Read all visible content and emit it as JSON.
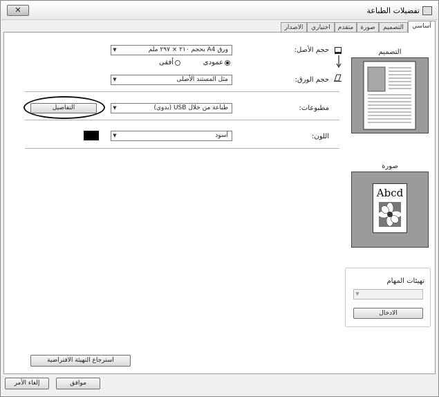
{
  "window": {
    "title": "تفضيلات الطباعة",
    "close_label": "✕"
  },
  "tabs": [
    {
      "label": "أساسي",
      "active": true
    },
    {
      "label": "التصميم",
      "active": false
    },
    {
      "label": "صورة",
      "active": false
    },
    {
      "label": "متقدم",
      "active": false
    },
    {
      "label": "اختياري",
      "active": false
    },
    {
      "label": "الاصدار",
      "active": false
    }
  ],
  "basic": {
    "original_size": {
      "label": "حجم الأصل:",
      "value": "ورق A4 بحجم ٢١٠ × ٢٩٧ ملم"
    },
    "orientation": {
      "portrait_label": "عمودى",
      "landscape_label": "أفقى",
      "selected": "portrait"
    },
    "paper_size": {
      "label": "حجم الورق:",
      "value": "مثل المستند الأصلى"
    },
    "output": {
      "label": "مطبوعات:",
      "value": "طباعة من خلال USB (بدوى)",
      "details_button": "التفاصيل"
    },
    "color": {
      "label": "اللون:",
      "value": "أسود",
      "swatch": "#000000"
    },
    "restore_button": "استرجاع التهيئة الافتراضية"
  },
  "side": {
    "layout_title": "التصميم",
    "image_title": "صورة",
    "image_sample_text": "Abcd",
    "task_presets": {
      "label": "تهيئات المهام",
      "value": "",
      "enter_button": "الادخال"
    }
  },
  "footer": {
    "ok_button": "موافق",
    "cancel_button": "إلغاء الأمر"
  }
}
